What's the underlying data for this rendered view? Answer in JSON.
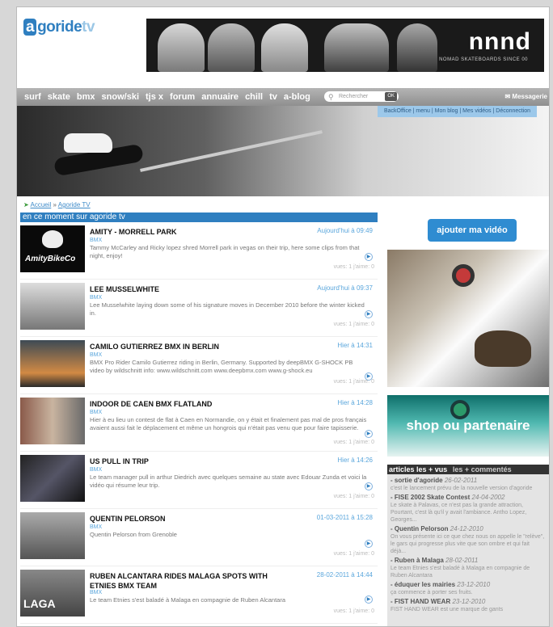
{
  "logo": {
    "part_a": "a",
    "part_b": "goride",
    "part_c": "tv"
  },
  "banner": {
    "brand": "nnnd",
    "tagline": "NOMAD SKATEBOARDS SINCE 00"
  },
  "nav": {
    "items": [
      "surf",
      "skate",
      "bmx",
      "snow/ski",
      "tjs x",
      "forum",
      "annuaire",
      "chill",
      "tv",
      "a-blog"
    ],
    "search_placeholder": "Rechercher",
    "search_button": "OK",
    "messagerie": "Messagerie"
  },
  "user_links": "BackOffice | menu | Mon blog | Mes vidéos | Déconnection",
  "breadcrumb": {
    "home": "Accueil",
    "sep": "»",
    "current": "Agoride TV"
  },
  "section_title": "en ce moment sur agoride tv",
  "videos": [
    {
      "title": "AMITY - MORRELL PARK",
      "date": "Aujourd'hui à 09:49",
      "category": "BMX",
      "description": "Tammy McCarley and Ricky lopez shred Morrell park in vegas on their trip, here some clips from that night, enjoy!",
      "stats": "vues: 1 j'aime: 0"
    },
    {
      "title": "LEE MUSSELWHITE",
      "date": "Aujourd'hui à 09:37",
      "category": "BMX",
      "description": "Lee Musselwhite laying down some of his signature moves in December 2010 before the winter kicked in.",
      "stats": "vues: 1 j'aime: 0"
    },
    {
      "title": "CAMILO GUTIERREZ BMX IN BERLIN",
      "date": "Hier à 14:31",
      "category": "BMX",
      "description": "BMX Pro Rider Camilo Gutierrez riding in Berlin, Germany. Supported by deepBMX G-SHOCK PB video by wildschnitt info: www.wildschnitt.com www.deepbmx.com www.g-shock.eu",
      "stats": "vues: 1 j'aime: 0"
    },
    {
      "title": "INDOOR DE CAEN BMX FLATLAND",
      "date": "Hier à 14:28",
      "category": "BMX",
      "description": "Hier à eu lieu un contest de flat à Caen en Normandie, on y était et finalement pas mal de pros français avaient aussi fait le déplacement et même un hongrois qui n'était pas venu que pour faire tapisserie.",
      "stats": "vues: 1 j'aime: 0"
    },
    {
      "title": "US PULL IN TRIP",
      "date": "Hier à 14:26",
      "category": "BMX",
      "description": "Le team manager pull in arthur Diedrich avec quelques semaine au state avec Edouar Zunda et voici la vidéo qui résume leur trip.",
      "stats": "vues: 1 j'aime: 0"
    },
    {
      "title": "QUENTIN PELORSON",
      "date": "01-03-2011 à 15:28",
      "category": "BMX",
      "description": "Quentin Pelorson from Grenoble",
      "stats": "vues: 1 j'aime: 0"
    },
    {
      "title": "RUBEN ALCANTARA RIDES MALAGA SPOTS WITH ETNIES BMX TEAM",
      "date": "28-02-2011 à 14:44",
      "category": "BMX",
      "description": "Le team Etnies s'est baladé à Malaga en compagnie de Ruben Alcantara",
      "stats": "vues: 1 j'aime: 0"
    }
  ],
  "sidebar": {
    "add_button": "ajouter ma vidéo",
    "shop_text": "shop ou partenaire",
    "tab_vus": "articles les + vus",
    "tab_commentes": "les + commentés",
    "articles": [
      {
        "title": "sortie d'agoride",
        "date": "26-02-2011",
        "text": "c'est le lancement prévu de la nouvelle version d'agoride"
      },
      {
        "title": "FISE 2002 Skate Contest",
        "date": "24-04-2002",
        "text": "Le skate à Palavas, ce n'est pas la grande attraction, Pourtant, c'est là qu'il y avait l'ambiance. Antho Lopez, Georges..."
      },
      {
        "title": "Quentin Pelorson",
        "date": "24-12-2010",
        "text": "On vous présente ici ce que chez nous on appelle le \"relève\", le gars qui progresse plus vite que son ombre et qui fait déjà..."
      },
      {
        "title": "Ruben à Malaga",
        "date": "28-02-2011",
        "text": "Le team Etnies s'est baladé à Malaga en compagnie de Ruben Alcantara"
      },
      {
        "title": "éduquer les mairies",
        "date": "23-12-2010",
        "text": "ça commence à porter ses fruits."
      },
      {
        "title": "FIST HAND WEAR",
        "date": "23-12-2010",
        "text": "FIST HAND WEAR est une marque de gants"
      }
    ]
  },
  "colors": {
    "accent": "#2f7fc0",
    "link": "#5aa6dc",
    "nav_bg": "#9f9f9f"
  }
}
